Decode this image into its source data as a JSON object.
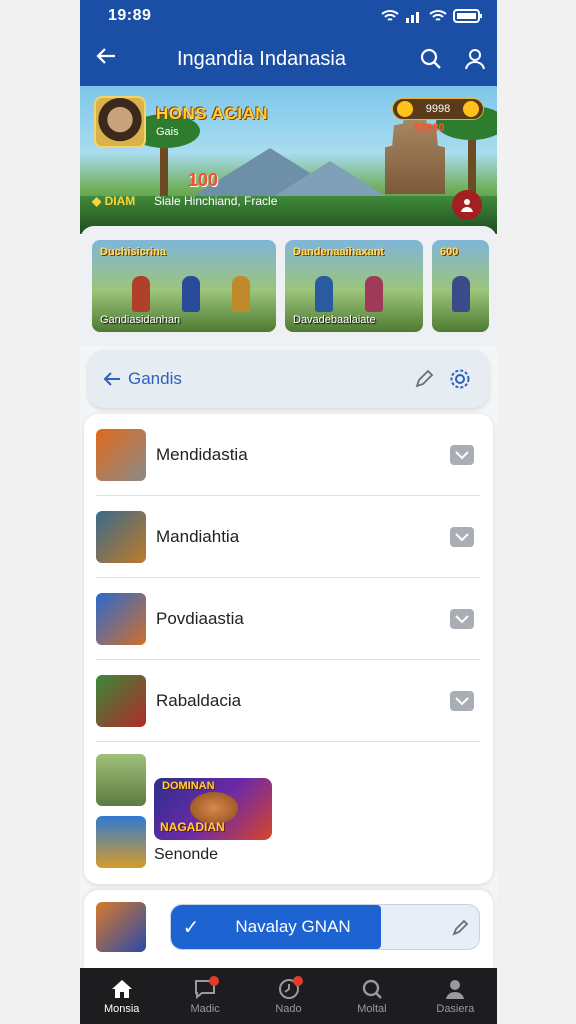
{
  "status": {
    "time": "19:89"
  },
  "appbar": {
    "title": "Ingandia Indanasia"
  },
  "hero": {
    "title": "HONS ACIAN",
    "subtitle": "Gais",
    "number": "100",
    "badge": "DIAM",
    "caption": "Siale Hinchiand, Fracle",
    "coins": "9998",
    "score": "53980"
  },
  "cards": [
    {
      "title": "Duchisicrina",
      "caption": "Gandiasidanhan"
    },
    {
      "title": "Dandenaaihaxant",
      "caption": "Davadebaalaiate"
    },
    {
      "title": "600",
      "caption": ""
    }
  ],
  "filter": {
    "label": "Gandis"
  },
  "list": {
    "items": [
      {
        "name": "Mendidastia",
        "checked": true
      },
      {
        "name": "Mandiahtia",
        "checked": true
      },
      {
        "name": "Povdiaastia",
        "checked": true
      },
      {
        "name": "Rabaldacia",
        "checked": true
      }
    ],
    "last": {
      "name": "Senonde",
      "promo_top": "DOMINAN",
      "promo_bottom": "NAGADIAN"
    }
  },
  "bottom": {
    "action_label": "Navalay GNAN"
  },
  "nav": {
    "items": [
      {
        "label": "Monsia",
        "icon": "home-icon",
        "active": true
      },
      {
        "label": "Madic",
        "icon": "chat-icon",
        "badge": true
      },
      {
        "label": "Nado",
        "icon": "clock-icon",
        "badge": true
      },
      {
        "label": "Moltal",
        "icon": "search-icon"
      },
      {
        "label": "Dasiera",
        "icon": "profile-icon"
      }
    ]
  },
  "colors": {
    "primary": "#1b4fa6",
    "accent": "#1e63d2",
    "nav_bg": "#1d1d1f"
  }
}
